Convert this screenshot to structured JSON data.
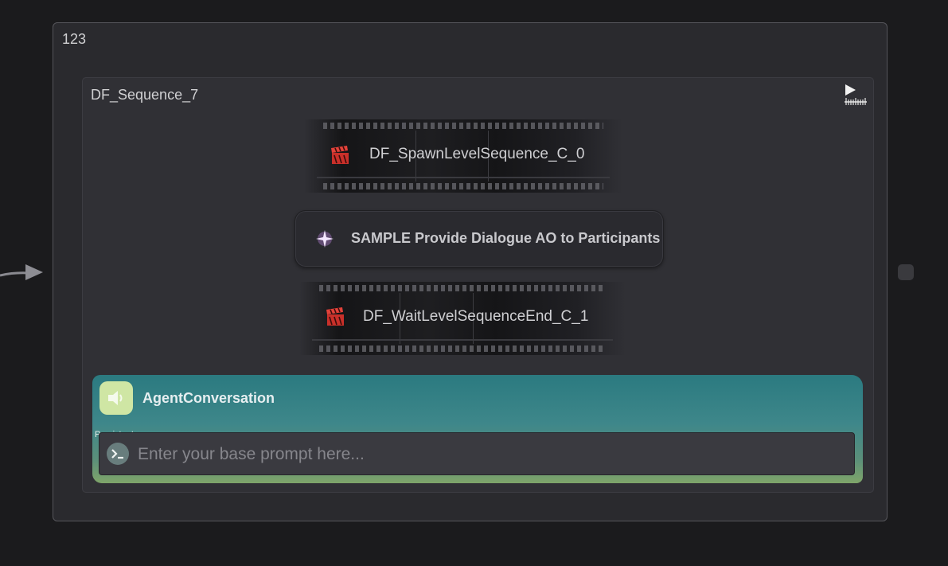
{
  "outer_node": {
    "title": "123"
  },
  "sequence_node": {
    "title": "DF_Sequence_7",
    "play_icon": "play-timeline-icon"
  },
  "steps": [
    {
      "type": "level-sequence",
      "label": "DF_SpawnLevelSequence_C_0",
      "icon": "clapperboard-icon",
      "icon_color": "#d8312b"
    },
    {
      "type": "action",
      "label": "SAMPLE Provide Dialogue AO to Participants",
      "icon": "sparkle-icon",
      "icon_color": "#c98cf0"
    },
    {
      "type": "level-sequence",
      "label": "DF_WaitLevelSequenceEnd_C_1",
      "icon": "clapperboard-icon",
      "icon_color": "#d8312b"
    }
  ],
  "agent": {
    "title": "AgentConversation",
    "icon": "speaker-icon",
    "persistent_label": "Persistent",
    "prompt_value": "",
    "prompt_placeholder": "Enter your base prompt here...",
    "prompt_icon": "terminal-icon"
  },
  "colors": {
    "canvas": "#1b1b1d",
    "node_bg": "#2a2a2e",
    "agent_gradient_top": "#2b7a80",
    "agent_gradient_bottom": "#7fa56a"
  }
}
